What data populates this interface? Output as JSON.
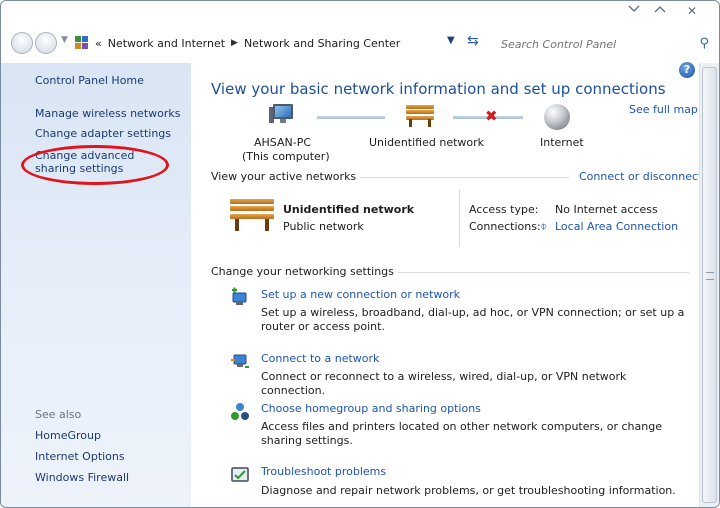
{
  "titlebar": {
    "minimize_icon": "chevron-down-icon",
    "maximize_icon": "chevron-up-icon",
    "close_glyph": "✕"
  },
  "addressbar": {
    "overflow_glyph": "«",
    "breadcrumbs": [
      "Network and Internet",
      "Network and Sharing Center"
    ],
    "search_placeholder": "Search Control Panel"
  },
  "sidebar": {
    "home": "Control Panel Home",
    "items": [
      "Manage wireless networks",
      "Change adapter settings",
      "Change advanced sharing settings"
    ],
    "see_also_label": "See also",
    "see_also": [
      "HomeGroup",
      "Internet Options",
      "Windows Firewall"
    ]
  },
  "main": {
    "title": "View your basic network information and set up connections",
    "see_full_map": "See full map",
    "map": {
      "computer_name": "AHSAN-PC",
      "computer_note": "(This computer)",
      "network": "Unidentified network",
      "internet": "Internet"
    },
    "active_networks_label": "View your active networks",
    "connect_or_disconnect": "Connect or disconnect",
    "active_network": {
      "name": "Unidentified network",
      "type": "Public network",
      "access_type_label": "Access type:",
      "access_type_value": "No Internet access",
      "connections_label": "Connections:",
      "connections_value": "Local Area Connection"
    },
    "change_settings_label": "Change your networking settings",
    "tasks": [
      {
        "title": "Set up a new connection or network",
        "description": "Set up a wireless, broadband, dial-up, ad hoc, or VPN connection; or set up a router or access point."
      },
      {
        "title": "Connect to a network",
        "description": "Connect or reconnect to a wireless, wired, dial-up, or VPN network connection."
      },
      {
        "title": "Choose homegroup and sharing options",
        "description": "Access files and printers located on other network computers, or change sharing settings."
      },
      {
        "title": "Troubleshoot problems",
        "description": "Diagnose and repair network problems, or get troubleshooting information."
      }
    ]
  },
  "colors": {
    "link": "#1c55b5",
    "heading": "#1e4f9a",
    "highlight_ellipse": "#e0141d",
    "error_x": "#d21d1d"
  }
}
